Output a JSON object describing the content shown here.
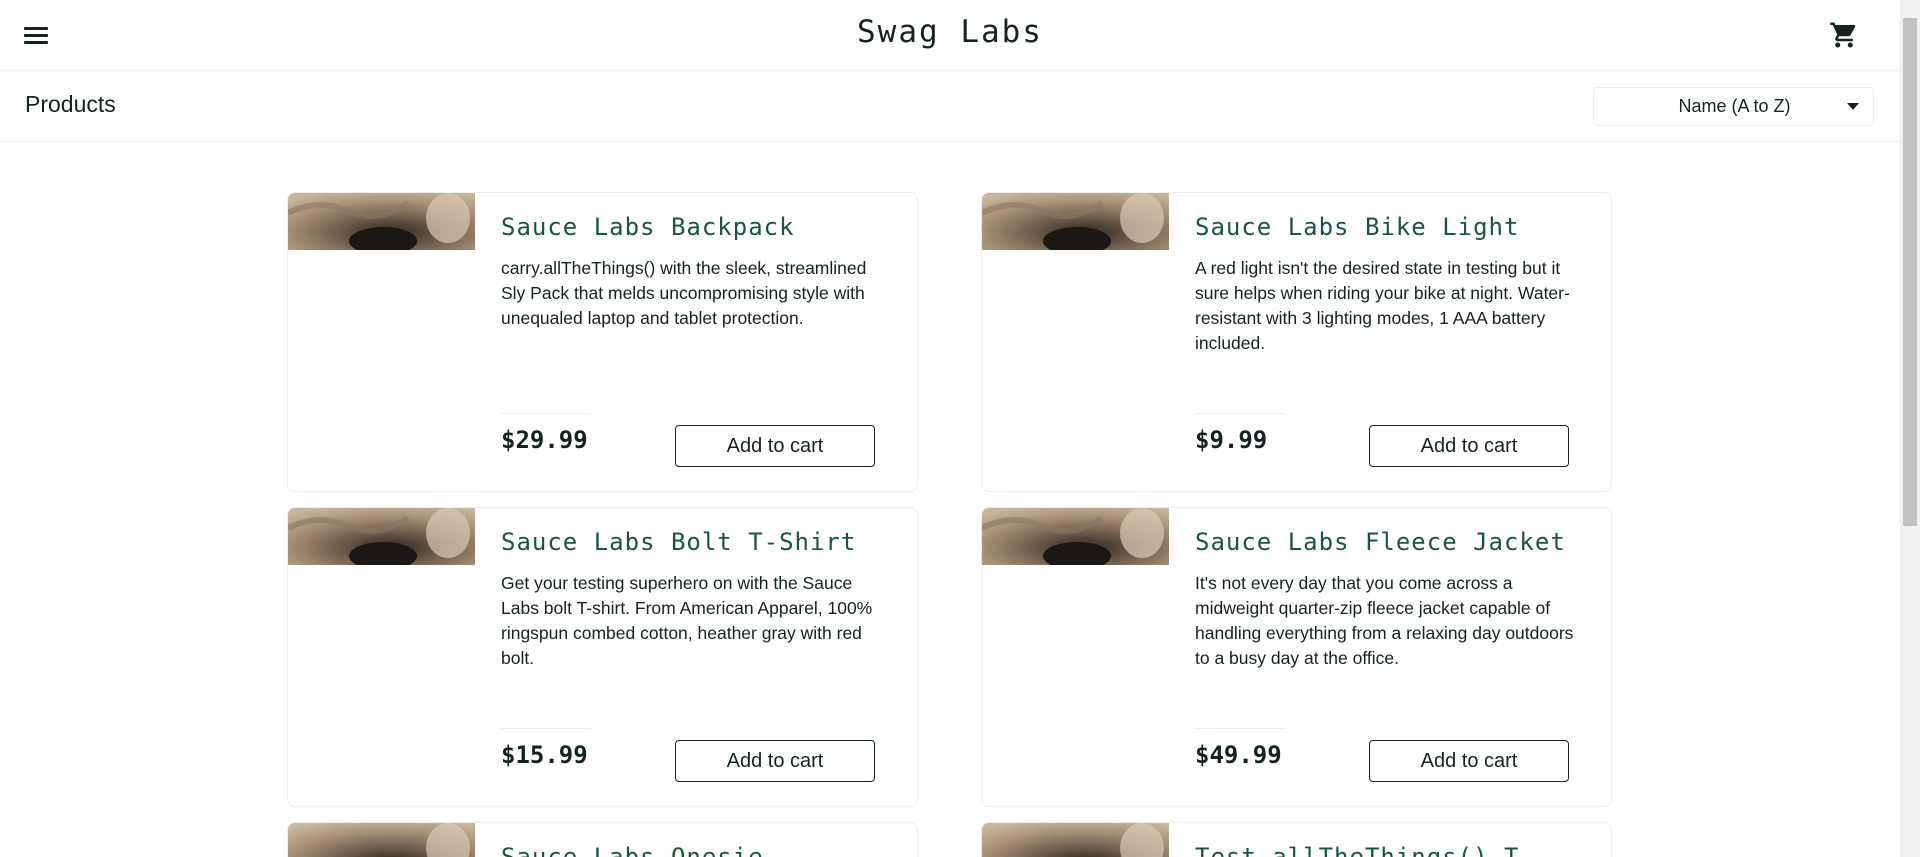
{
  "header": {
    "app_title": "Swag Labs",
    "menu_icon": "hamburger-menu-icon",
    "cart_icon": "shopping-cart-icon"
  },
  "subheader": {
    "title": "Products",
    "sort": {
      "selected": "Name (A to Z)",
      "caret_icon": "caret-down-icon"
    }
  },
  "inventory": {
    "items": [
      {
        "name": "Sauce Labs Backpack",
        "description": "carry.allTheThings() with the sleek, streamlined Sly Pack that melds uncompromising style with unequaled laptop and tablet protection.",
        "price": "$29.99",
        "button_label": "Add to cart"
      },
      {
        "name": "Sauce Labs Bike Light",
        "description": "A red light isn't the desired state in testing but it sure helps when riding your bike at night. Water-resistant with 3 lighting modes, 1 AAA battery included.",
        "price": "$9.99",
        "button_label": "Add to cart"
      },
      {
        "name": "Sauce Labs Bolt T-Shirt",
        "description": "Get your testing superhero on with the Sauce Labs bolt T-shirt. From American Apparel, 100% ringspun combed cotton, heather gray with red bolt.",
        "price": "$15.99",
        "button_label": "Add to cart"
      },
      {
        "name": "Sauce Labs Fleece Jacket",
        "description": "It's not every day that you come across a midweight quarter-zip fleece jacket capable of handling everything from a relaxing day outdoors to a busy day at the office.",
        "price": "$49.99",
        "button_label": "Add to cart"
      },
      {
        "name": "Sauce Labs Onesie"
      },
      {
        "name": "Test.allTheThings() T-"
      }
    ]
  },
  "colors": {
    "item_name": "#18583a",
    "text": "#132322",
    "border": "#ededed"
  }
}
